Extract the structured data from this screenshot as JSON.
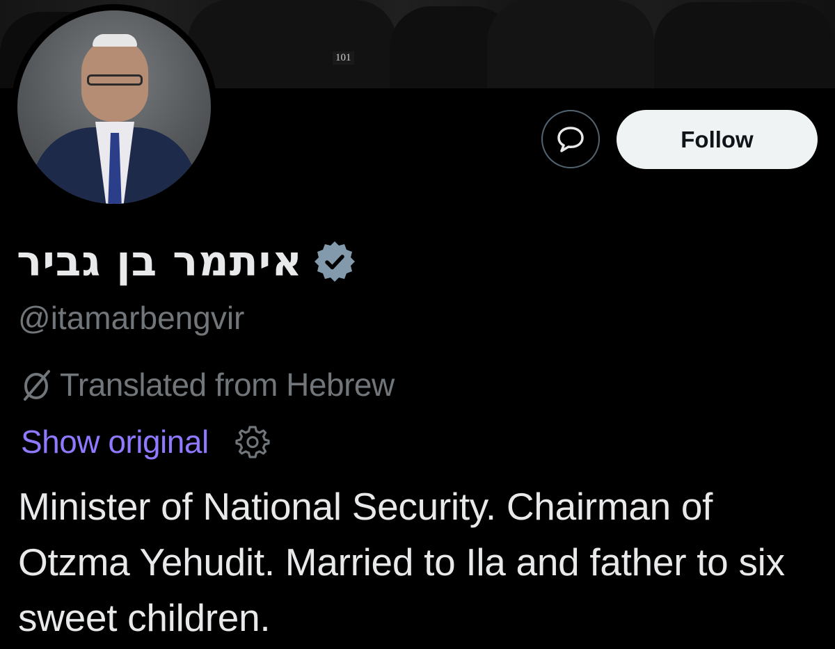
{
  "banner": {
    "badge_text": "101"
  },
  "actions": {
    "message_icon": "chat-bubble-icon",
    "follow_label": "Follow"
  },
  "profile": {
    "display_name": "איתמר בן גביר",
    "verified_icon": "verified-badge-icon",
    "handle": "@itamarbengvir"
  },
  "translation": {
    "icon": "translate-icon",
    "notice": "Translated from Hebrew",
    "show_original_label": "Show original",
    "settings_icon": "gear-icon"
  },
  "bio": {
    "text": "Minister of National Security. Chairman of Otzma Yehudit. Married to Ila and father to six sweet children."
  },
  "colors": {
    "background": "#000000",
    "primary_text": "#e7e9ea",
    "secondary_text": "#71767b",
    "link": "#8f79ff",
    "follow_bg": "#eff3f4",
    "verified_badge": "#829aab"
  }
}
